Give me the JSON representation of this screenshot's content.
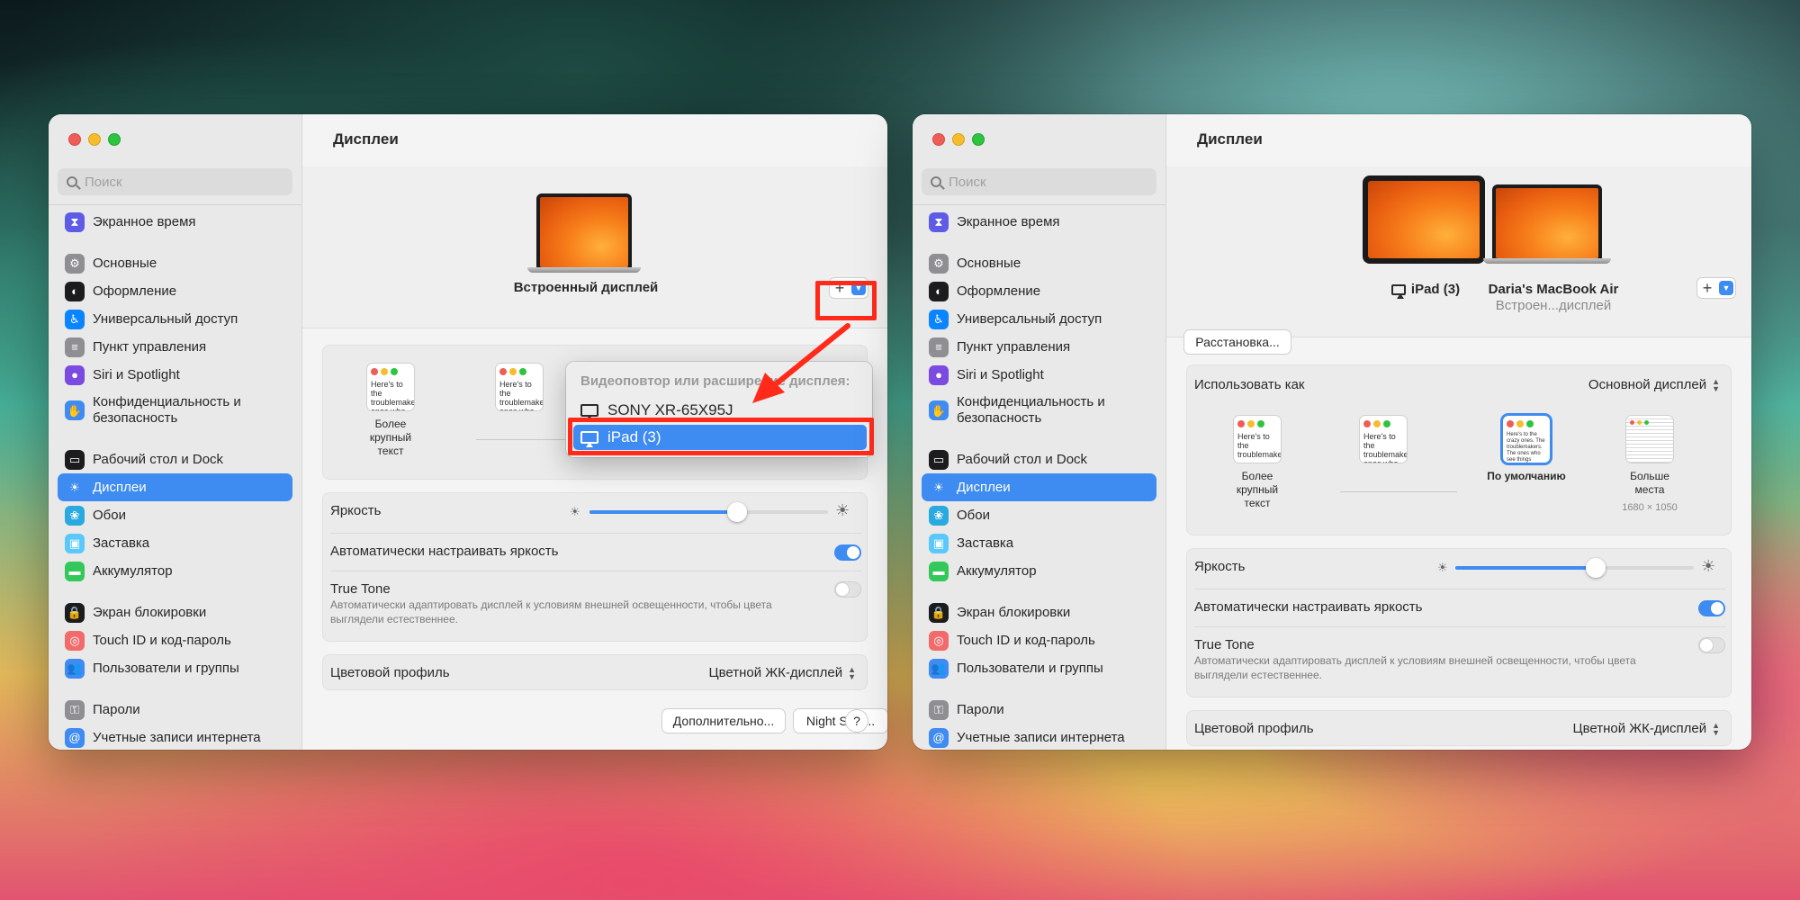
{
  "colors": {
    "accent": "#3e8bf1",
    "highlight": "#ff2a1a"
  },
  "sidebar": {
    "search_placeholder": "Поиск",
    "items": [
      {
        "label": "Экранное время",
        "icon": "hourglass-icon",
        "color": "#5e5ce6"
      },
      {
        "label": "Основные",
        "icon": "gear-icon",
        "color": "#8e8e93"
      },
      {
        "label": "Оформление",
        "icon": "appearance-icon",
        "color": "#1c1c1e"
      },
      {
        "label": "Универсальный доступ",
        "icon": "accessibility-icon",
        "color": "#0a84ff"
      },
      {
        "label": "Пункт управления",
        "icon": "control-center-icon",
        "color": "#8e8e93"
      },
      {
        "label": "Siri и Spotlight",
        "icon": "siri-icon",
        "color": "#7b4ae0"
      },
      {
        "label": "Конфиденциальность и безопасность",
        "icon": "hand-icon",
        "color": "#3e8bf1"
      },
      {
        "label": "Рабочий стол и Dock",
        "icon": "dock-icon",
        "color": "#1c1c1e"
      },
      {
        "label": "Дисплеи",
        "icon": "sun-icon",
        "color": "#3e8bf1"
      },
      {
        "label": "Обои",
        "icon": "wallpaper-icon",
        "color": "#2aa9e0"
      },
      {
        "label": "Заставка",
        "icon": "screensaver-icon",
        "color": "#5ac8fa"
      },
      {
        "label": "Аккумулятор",
        "icon": "battery-icon",
        "color": "#34c759"
      },
      {
        "label": "Экран блокировки",
        "icon": "lock-icon",
        "color": "#1c1c1e"
      },
      {
        "label": "Touch ID и код-пароль",
        "icon": "fingerprint-icon",
        "color": "#f26b6b"
      },
      {
        "label": "Пользователи и группы",
        "icon": "users-icon",
        "color": "#3e8bf1"
      },
      {
        "label": "Пароли",
        "icon": "key-icon",
        "color": "#8e8e93"
      },
      {
        "label": "Учетные записи интернета",
        "icon": "at-icon",
        "color": "#3e8bf1"
      }
    ]
  },
  "left": {
    "title": "Дисплеи",
    "display_name": "Встроенный дисплей",
    "plus_label": "+",
    "thumbs": [
      {
        "caption": "Более крупный текст",
        "sample": "Here's to the troublemakers, ones who"
      },
      {
        "caption": "",
        "sample": "Here's to the troublemakers, ones who"
      }
    ],
    "brightness_label": "Яркость",
    "brightness_level": 0.62,
    "auto_brightness_label": "Автоматически настраивать яркость",
    "true_tone_label": "True Tone",
    "true_tone_desc": "Автоматически адаптировать дисплей к условиям внешней освещенности, чтобы цвета выглядели естественнее.",
    "color_profile_label": "Цветовой профиль",
    "color_profile_value": "Цветной ЖК-дисплей",
    "btn_advanced": "Дополнительно...",
    "btn_night_shift": "Night Shift...",
    "btn_help": "?",
    "dropdown": {
      "header": "Видеоповтор или расширение дисплея:",
      "items": [
        {
          "label": "SONY XR-65X95J",
          "selected": false
        },
        {
          "label": "iPad (3)",
          "selected": true
        }
      ]
    }
  },
  "right": {
    "title": "Дисплеи",
    "btn_arrangement": "Расстановка...",
    "ipad_label": "iPad (3)",
    "mac_label": "Daria's MacBook Air",
    "mac_sub": "Встроен...дисплей",
    "plus_label": "+",
    "use_as_label": "Использовать как",
    "use_as_value": "Основной дисплей",
    "thumbs": [
      {
        "caption": "Более крупный текст",
        "sample": "Here's to the troublemakers"
      },
      {
        "caption": "",
        "sample": "Here's to the troublemakers, ones who"
      },
      {
        "caption": "По умолчанию",
        "sample": "Here's to the crazy ones. The troublemakers. The ones who see things differently. rules. And they"
      },
      {
        "caption": "Больше места",
        "sample": "",
        "resolution": "1680 × 1050"
      }
    ],
    "brightness_label": "Яркость",
    "brightness_level": 0.59,
    "auto_brightness_label": "Автоматически настраивать яркость",
    "true_tone_label": "True Tone",
    "true_tone_desc": "Автоматически адаптировать дисплей к условиям внешней освещенности, чтобы цвета выглядели естественнее.",
    "color_profile_label": "Цветовой профиль",
    "color_profile_value": "Цветной ЖК-дисплей"
  }
}
